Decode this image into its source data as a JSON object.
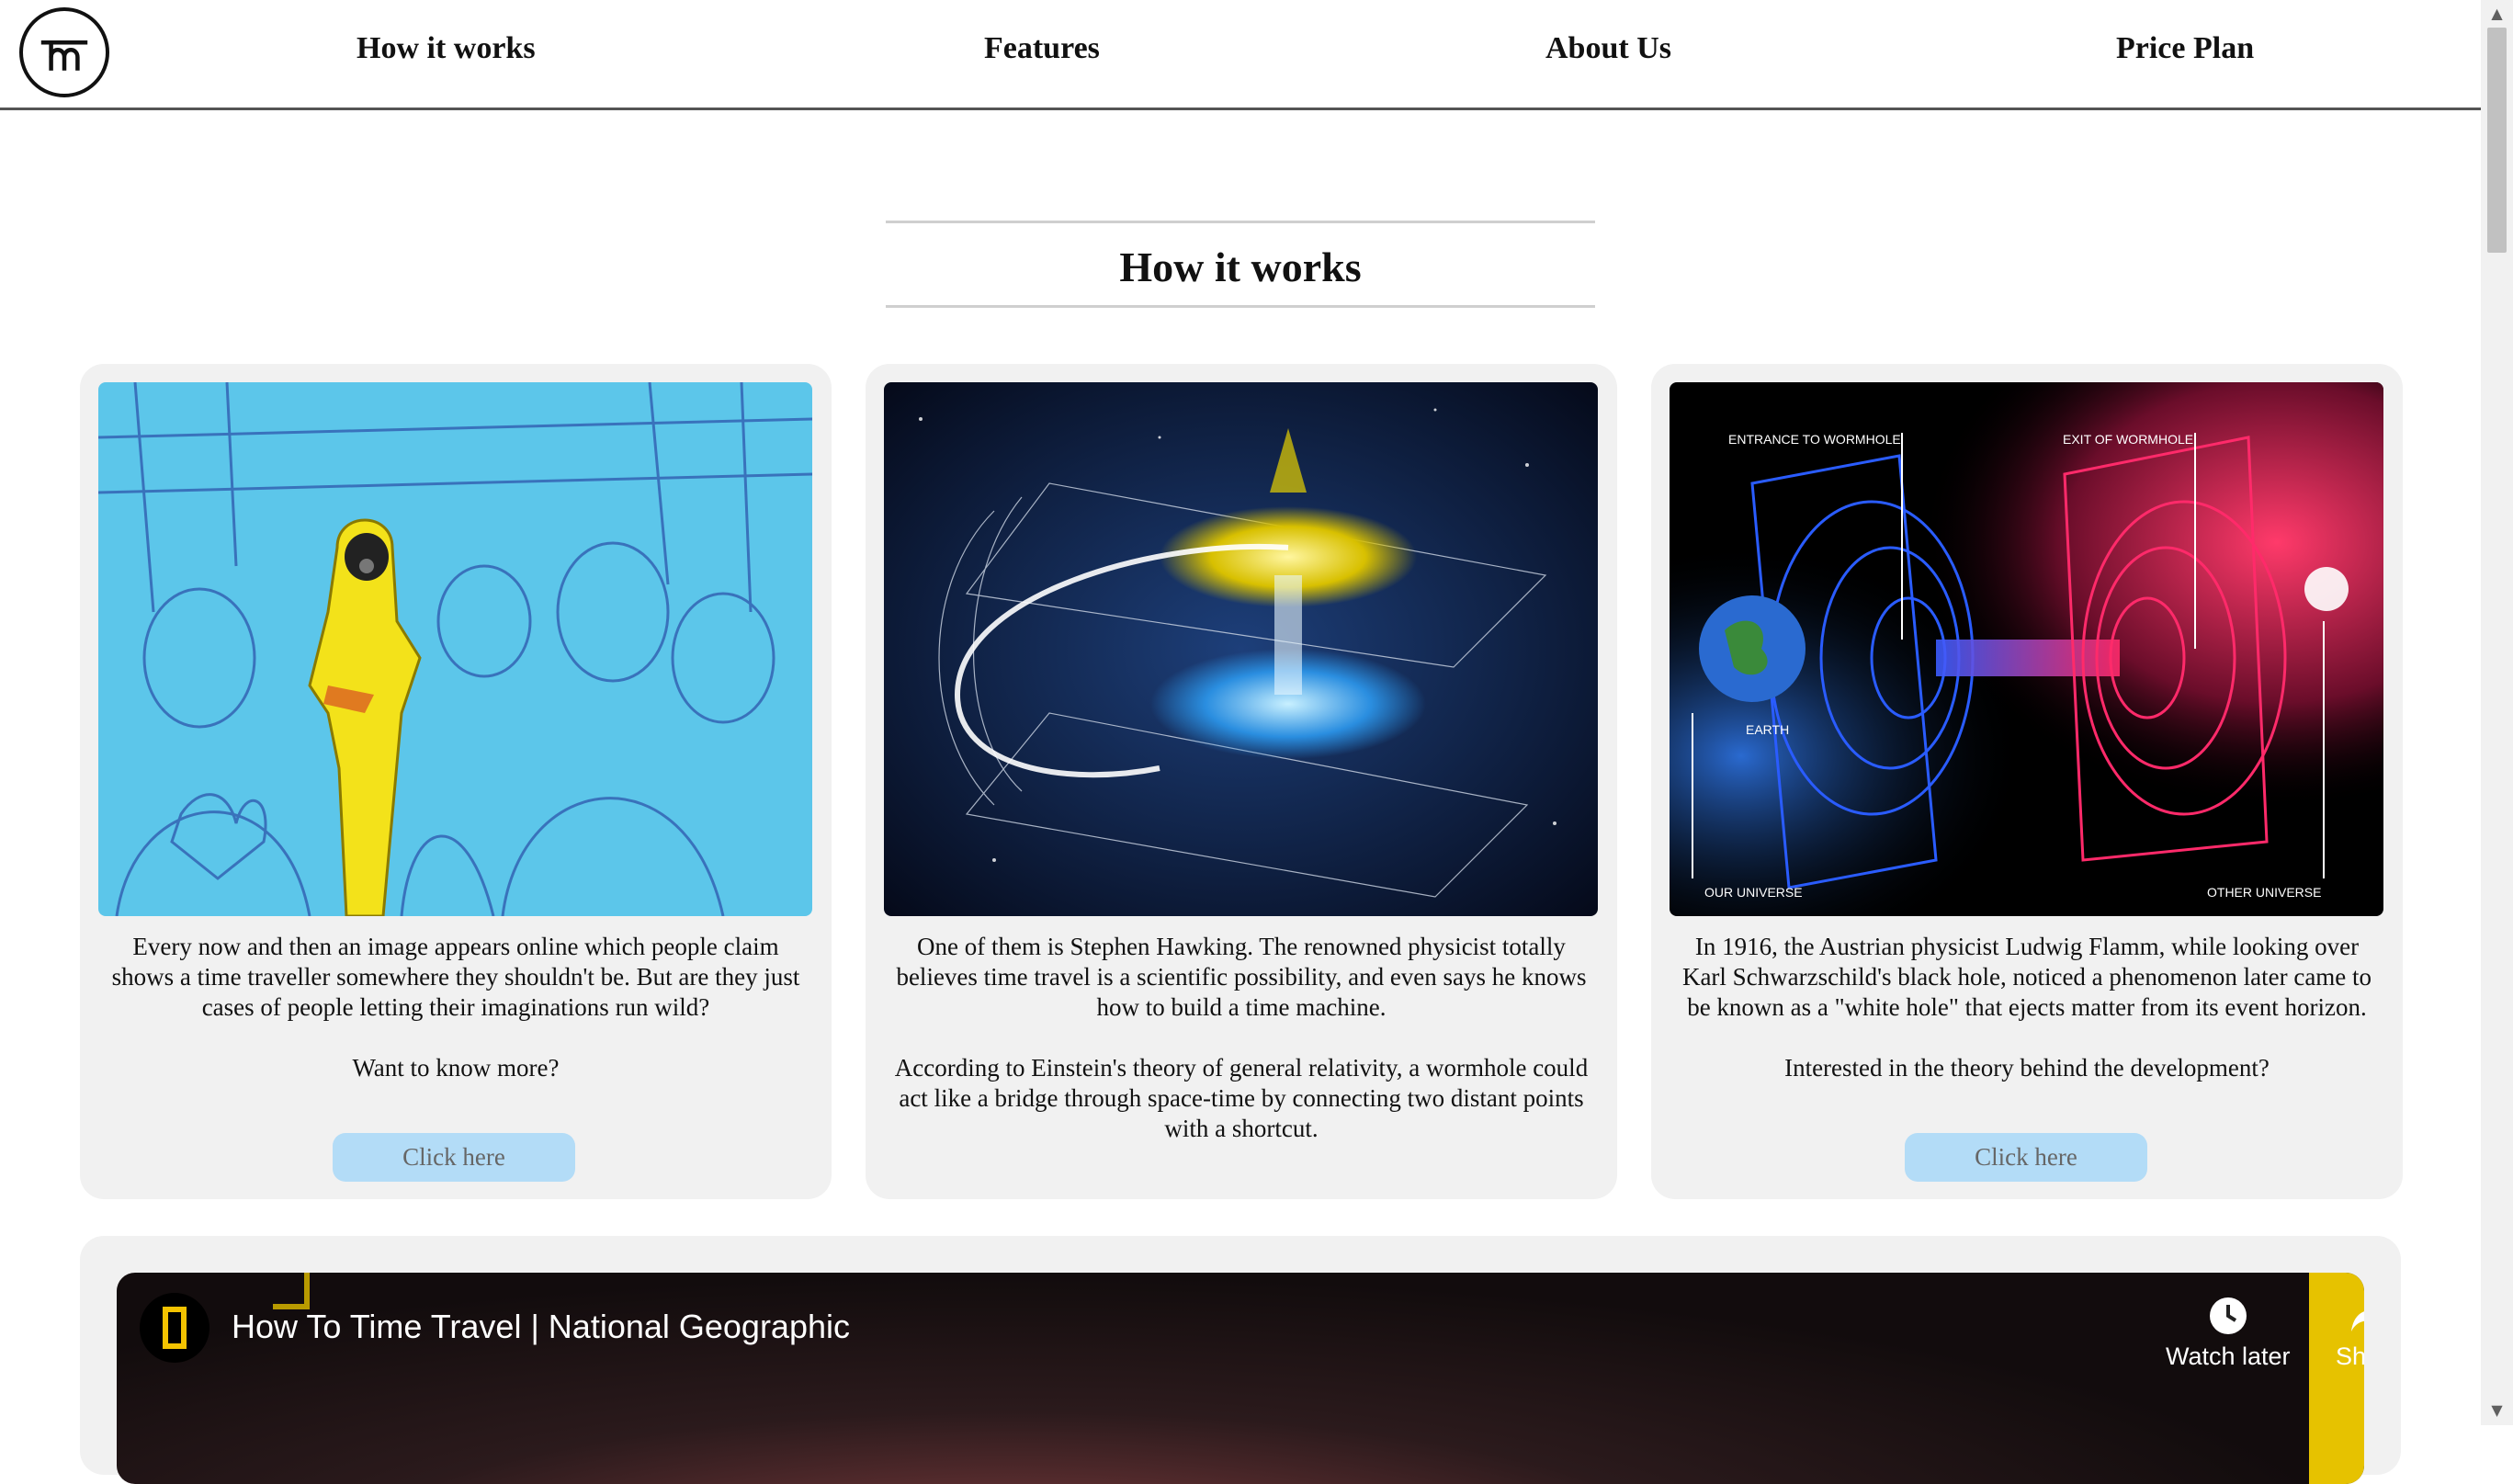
{
  "nav": {
    "logo_alt": "TM logo",
    "items": [
      "How it works",
      "Features",
      "About Us",
      "Price Plan"
    ]
  },
  "section": {
    "title": "How it works"
  },
  "cards": [
    {
      "image_labels": [],
      "paragraphs": [
        "Every now and then an image appears online which people claim shows a time traveller somewhere they shouldn't be. But are they just cases of people letting their imaginations run wild?",
        "Want to know more?"
      ],
      "button": "Click here"
    },
    {
      "image_labels": [],
      "paragraphs": [
        "One of them is Stephen Hawking. The renowned physicist totally believes time travel is a scientific possibility, and even says he knows how to build a time machine.",
        "According to Einstein's theory of general relativity, a wormhole could act like a bridge through space-time by connecting two distant points with a shortcut."
      ]
    },
    {
      "image_labels": [
        "ENTRANCE TO WORMHOLE",
        "EXIT OF WORMHOLE",
        "EARTH",
        "OUR UNIVERSE",
        "OTHER UNIVERSE"
      ],
      "paragraphs": [
        "In 1916, the Austrian physicist Ludwig Flamm, while looking over Karl Schwarzschild's black hole, noticed a phenomenon later came to be known as a \"white hole\" that ejects matter from its event horizon.",
        "Interested in the theory behind the development?"
      ],
      "button": "Click here"
    }
  ],
  "video": {
    "title": "How To Time Travel | National Geographic",
    "watch_later": "Watch later",
    "share": "Share"
  },
  "colors": {
    "card_bg": "#f1f1f1",
    "button_bg": "#b3dcf7",
    "header_border": "#555555",
    "natgeo_yellow": "#f4c300"
  }
}
